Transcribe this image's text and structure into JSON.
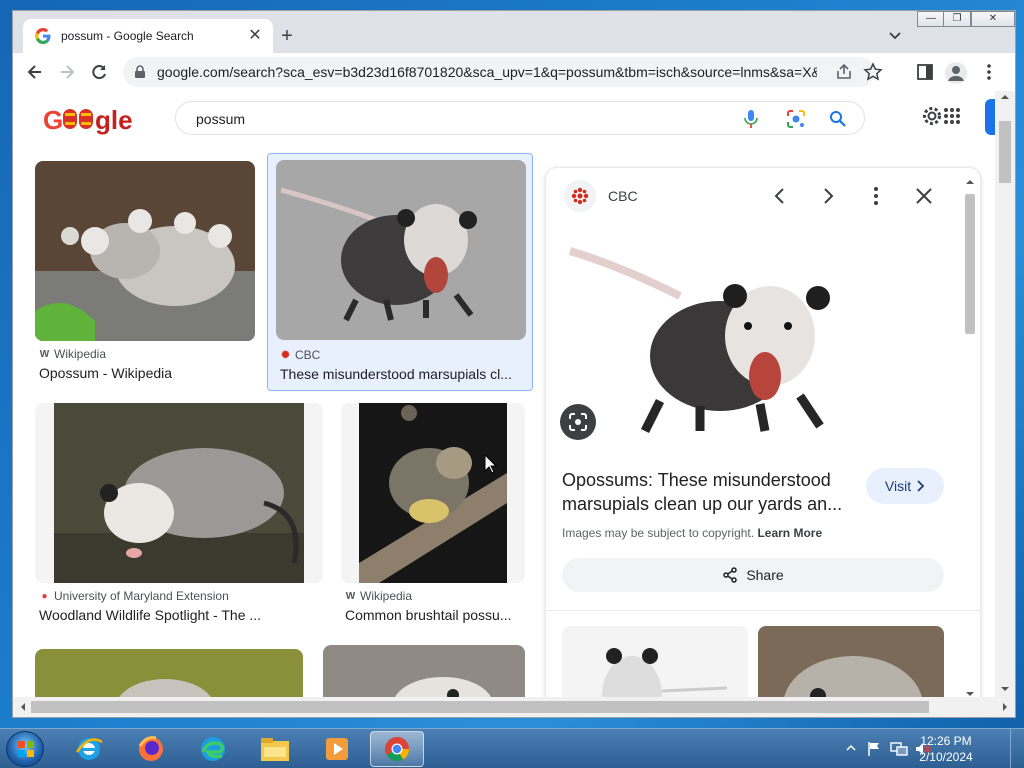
{
  "browser": {
    "tab_title": "possum - Google Search",
    "url": "google.com/search?sca_esv=b3d23d16f8701820&sca_upv=1&q=possum&tbm=isch&source=lnms&sa=X&..."
  },
  "search": {
    "query": "possum"
  },
  "results": [
    {
      "source": "Wikipedia",
      "title": "Opossum - Wikipedia"
    },
    {
      "source": "CBC",
      "title": "These misunderstood marsupials cl..."
    },
    {
      "source": "University of Maryland Extension",
      "title": "Woodland Wildlife Spotlight - The ..."
    },
    {
      "source": "Wikipedia",
      "title": "Common brushtail possu..."
    }
  ],
  "panel": {
    "source": "CBC",
    "title": "Opossums: These misunderstood marsupials clean up our yards an...",
    "visit_label": "Visit",
    "note": "Images may be subject to copyright.",
    "learn_more": "Learn More",
    "share_label": "Share"
  },
  "taskbar": {
    "time": "12:26 PM",
    "date": "2/10/2024"
  },
  "colors": {
    "accent": "#1a73e8",
    "visit_bg": "#e8f0fe",
    "desktop": "#1d7fcf"
  }
}
